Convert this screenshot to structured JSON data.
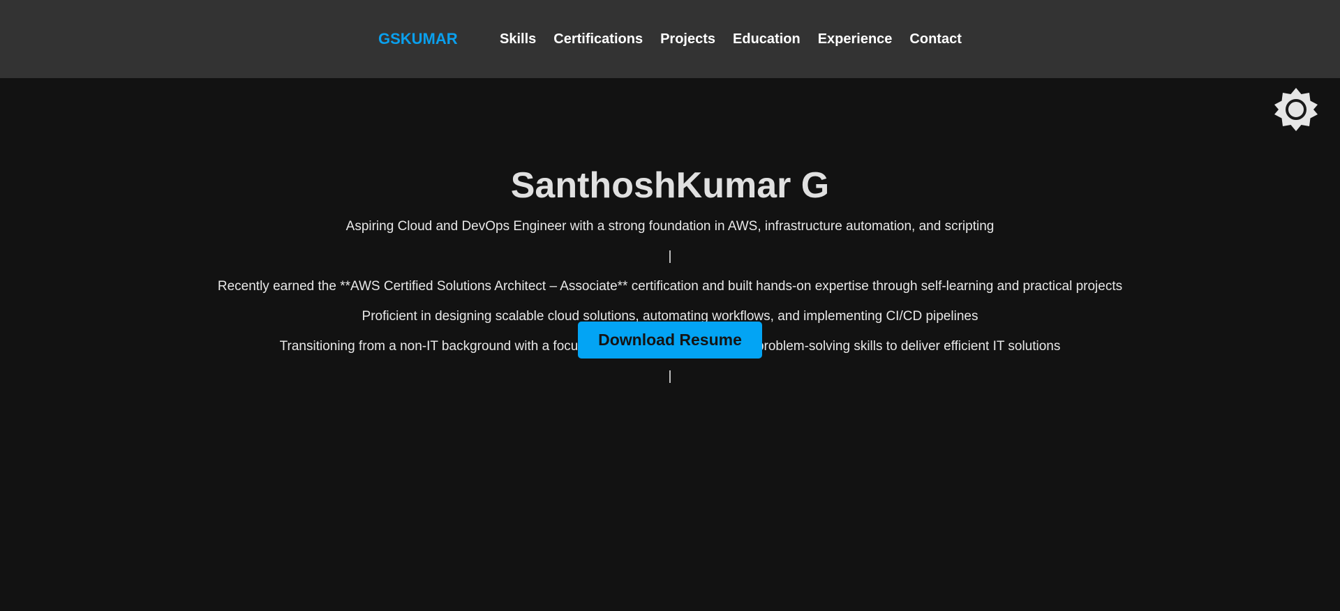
{
  "nav": {
    "brand": "GSKUMAR",
    "links": [
      "Skills",
      "Certifications",
      "Projects",
      "Education",
      "Experience",
      "Contact"
    ]
  },
  "theme_toggle": {
    "icon": "sun-icon"
  },
  "hero": {
    "name": "SanthoshKumar G",
    "tagline": "Aspiring Cloud and DevOps Engineer with a strong foundation in AWS, infrastructure automation, and scripting",
    "separator_1": "|",
    "line_1": "Recently earned the **AWS Certified Solutions Architect – Associate** certification and built hands-on expertise through self-learning and practical projects",
    "line_2": "Proficient in designing scalable cloud solutions, automating workflows, and implementing CI/CD pipelines",
    "line_3": "Transitioning from a non-IT background with a focus on leveraging analytical and problem-solving skills to deliver efficient IT solutions",
    "separator_2": "|",
    "resume_button": "Download Resume"
  },
  "colors": {
    "navbar_bg": "#333333",
    "page_bg": "#121212",
    "brand": "#0aa0ee",
    "button_bg": "#03a4f4"
  }
}
